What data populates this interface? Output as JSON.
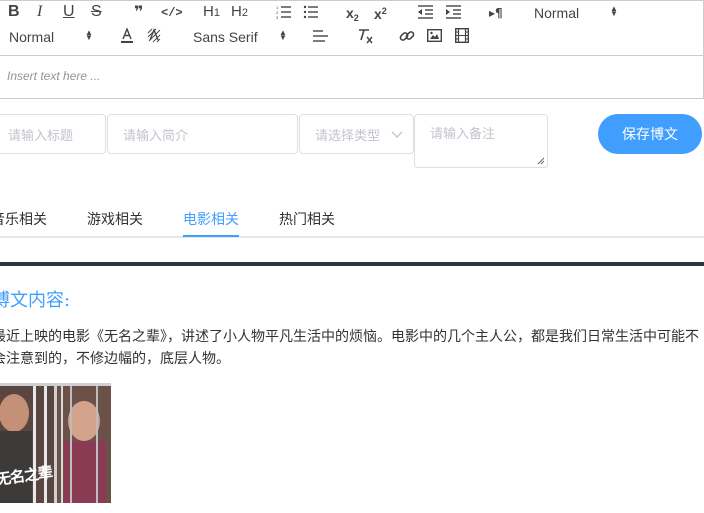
{
  "toolbar": {
    "header_select": "Normal",
    "size_select": "Normal",
    "font_select": "Sans Serif",
    "icons": {
      "bold": "B",
      "italic": "I",
      "underline": "U",
      "strike": "S",
      "blockquote": "❞",
      "code": "</>",
      "h1": "H",
      "h1_sub": "1",
      "h2": "H",
      "h2_sub": "2",
      "subscript": "x",
      "subscript_sub": "2",
      "superscript": "x",
      "superscript_sup": "2",
      "rtl": "▸¶"
    }
  },
  "editor": {
    "placeholder": "Insert text here ..."
  },
  "form": {
    "title_placeholder": "请输入标题",
    "intro_placeholder": "请输入简介",
    "type_placeholder": "请选择类型",
    "note_placeholder": "请输入备注",
    "save_label": "保存博文"
  },
  "tabs": [
    {
      "label": "音乐相关",
      "active": false
    },
    {
      "label": "游戏相关",
      "active": false
    },
    {
      "label": "电影相关",
      "active": true
    },
    {
      "label": "热门相关",
      "active": false
    }
  ],
  "content": {
    "title": "博文内容:",
    "body": "最近上映的电影《无名之辈》，讲述了小人物平凡生活中的烦恼。电影中的几个主人公，都是我们日常生活中可能不会注意到的，不修边幅的，底层人物。",
    "poster_text": "无名之辈"
  },
  "colors": {
    "accent": "#409eff",
    "divider": "#2e3440",
    "border": "#dcdfe6",
    "placeholder": "#c0c4cc"
  }
}
